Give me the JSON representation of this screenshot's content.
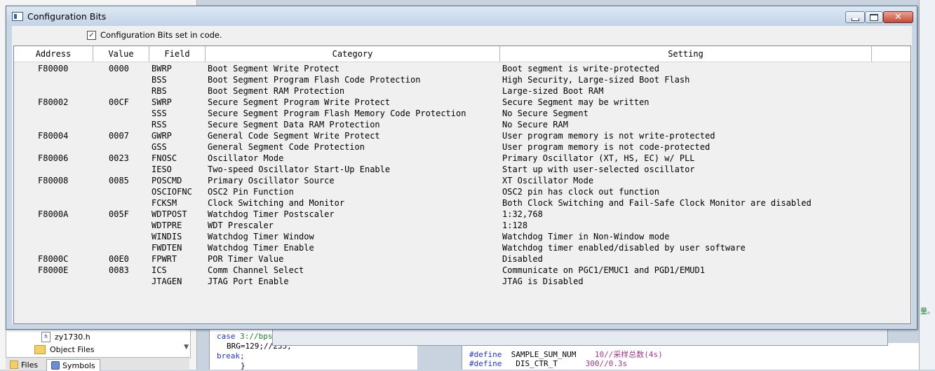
{
  "background": {
    "tree": [
      {
        "label": "zy1730.h",
        "icon": "header-file-icon"
      },
      {
        "label": "Object Files",
        "icon": "folder-icon"
      }
    ],
    "tabs": [
      {
        "label": "Files",
        "icon": "folder-icon"
      },
      {
        "label": "Symbols",
        "icon": "symbols-icon"
      }
    ],
    "code_left": {
      "line1_kw": "case",
      "line1_rest": " 3://bps",
      "line2": "BRG=129;//235;",
      "line3": "break;",
      "line4": "}"
    },
    "code_right": {
      "line1_kw": "#define",
      "line1_name": "  SAMPLE_SUM_NUM",
      "line1_val": "    10//采样总数(4s)",
      "line2_kw": "#define",
      "line2_name": "   DIS_CTR_T",
      "line2_val": "      300//0.3s"
    },
    "side_glyph": "量。"
  },
  "dialog": {
    "title": "Configuration Bits",
    "checkbox_label": "Configuration Bits set in code.",
    "checkbox_checked": true,
    "checkbox_mark": "✓",
    "close_glyph": "✕"
  },
  "table": {
    "columns": [
      "Address",
      "Value",
      "Field",
      "Category",
      "Setting"
    ],
    "rows": [
      {
        "address": "F80000",
        "value": "0000",
        "field": "BWRP",
        "category": "Boot Segment Write Protect",
        "setting": "Boot segment is write-protected"
      },
      {
        "address": "",
        "value": "",
        "field": "BSS",
        "category": "Boot Segment Program Flash Code Protection",
        "setting": "High Security, Large-sized Boot Flash"
      },
      {
        "address": "",
        "value": "",
        "field": "RBS",
        "category": "Boot Segment RAM Protection",
        "setting": "Large-sized Boot RAM"
      },
      {
        "address": "F80002",
        "value": "00CF",
        "field": "SWRP",
        "category": "Secure Segment Program Write Protect",
        "setting": "Secure Segment may be written"
      },
      {
        "address": "",
        "value": "",
        "field": "SSS",
        "category": "Secure Segment Program Flash Memory Code Protection",
        "setting": "No Secure Segment"
      },
      {
        "address": "",
        "value": "",
        "field": "RSS",
        "category": "Secure Segment Data RAM Protection",
        "setting": "No Secure RAM"
      },
      {
        "address": "F80004",
        "value": "0007",
        "field": "GWRP",
        "category": "General Code Segment Write Protect",
        "setting": "User program memory is not write-protected"
      },
      {
        "address": "",
        "value": "",
        "field": "GSS",
        "category": "General Segment Code Protection",
        "setting": "User program memory is not code-protected"
      },
      {
        "address": "F80006",
        "value": "0023",
        "field": "FNOSC",
        "category": "Oscillator Mode",
        "setting": "Primary Oscillator (XT, HS, EC) w/ PLL"
      },
      {
        "address": "",
        "value": "",
        "field": "IESO",
        "category": "Two-speed Oscillator Start-Up Enable",
        "setting": "Start up with user-selected oscillator"
      },
      {
        "address": "F80008",
        "value": "0085",
        "field": "POSCMD",
        "category": "Primary Oscillator Source",
        "setting": "XT Oscillator Mode"
      },
      {
        "address": "",
        "value": "",
        "field": "OSCIOFNC",
        "category": "OSC2 Pin Function",
        "setting": "OSC2 pin has clock out function"
      },
      {
        "address": "",
        "value": "",
        "field": "FCKSM",
        "category": "Clock Switching and Monitor",
        "setting": "Both Clock Switching and Fail-Safe Clock Monitor are disabled"
      },
      {
        "address": "F8000A",
        "value": "005F",
        "field": "WDTPOST",
        "category": "Watchdog Timer Postscaler",
        "setting": "1:32,768"
      },
      {
        "address": "",
        "value": "",
        "field": "WDTPRE",
        "category": "WDT Prescaler",
        "setting": "1:128"
      },
      {
        "address": "",
        "value": "",
        "field": "WINDIS",
        "category": "Watchdog Timer Window",
        "setting": "Watchdog Timer in Non-Window mode"
      },
      {
        "address": "",
        "value": "",
        "field": "FWDTEN",
        "category": "Watchdog Timer Enable",
        "setting": "Watchdog timer enabled/disabled by user software"
      },
      {
        "address": "F8000C",
        "value": "00E0",
        "field": "FPWRT",
        "category": "POR Timer Value",
        "setting": "Disabled"
      },
      {
        "address": "F8000E",
        "value": "0083",
        "field": "ICS",
        "category": "Comm Channel Select",
        "setting": "Communicate on PGC1/EMUC1 and PGD1/EMUD1"
      },
      {
        "address": "",
        "value": "",
        "field": "JTAGEN",
        "category": "JTAG Port Enable",
        "setting": "JTAG is Disabled"
      }
    ]
  }
}
